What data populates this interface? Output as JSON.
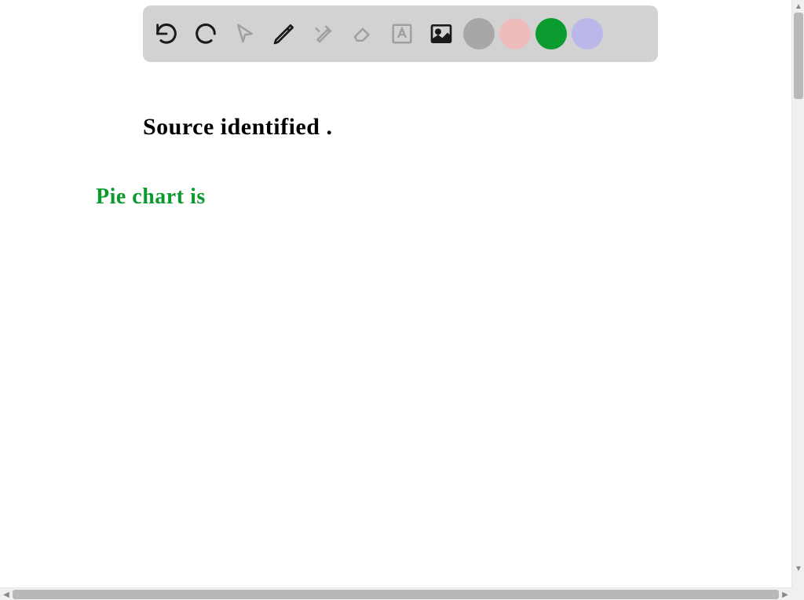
{
  "toolbar": {
    "tools": [
      {
        "name": "undo",
        "icon": "undo-icon"
      },
      {
        "name": "redo",
        "icon": "redo-icon"
      },
      {
        "name": "pointer",
        "icon": "pointer-icon"
      },
      {
        "name": "pencil",
        "icon": "pencil-icon"
      },
      {
        "name": "build",
        "icon": "build-tools-icon"
      },
      {
        "name": "eraser",
        "icon": "eraser-icon"
      },
      {
        "name": "text",
        "icon": "text-icon"
      },
      {
        "name": "image",
        "icon": "image-icon"
      }
    ],
    "colors": [
      {
        "name": "gray",
        "hex": "#a7a7a7"
      },
      {
        "name": "pink",
        "hex": "#eebcbc"
      },
      {
        "name": "green",
        "hex": "#0c9b2f"
      },
      {
        "name": "lavender",
        "hex": "#bab7ea"
      }
    ]
  },
  "canvas": {
    "line1": {
      "text": "Source identified .",
      "color": "#000000"
    },
    "line2": {
      "text": "Pie chart is",
      "color": "#0a9a2e"
    }
  }
}
